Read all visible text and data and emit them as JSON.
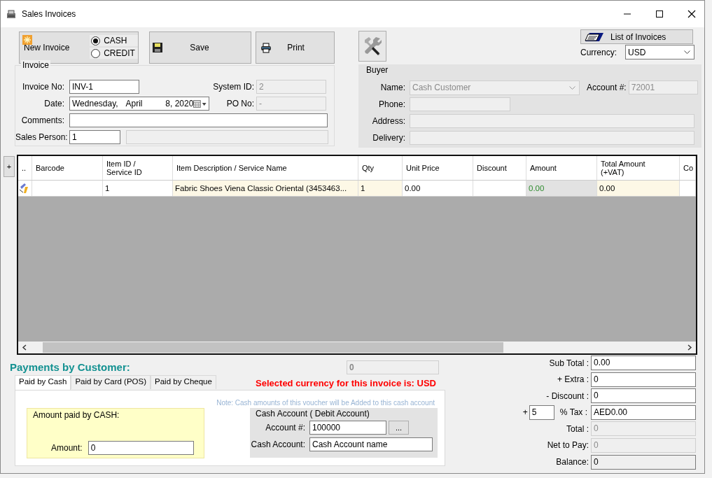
{
  "window": {
    "title": "Sales Invoices"
  },
  "toolbar": {
    "new_invoice": "New Invoice",
    "payment_types": [
      {
        "label": "CASH",
        "selected": true
      },
      {
        "label": "CREDIT",
        "selected": false
      }
    ],
    "save": "Save",
    "print": "Print",
    "list_of_invoices": "List of Invoices",
    "currency": {
      "label": "Currency:",
      "value": "USD"
    }
  },
  "invoice": {
    "title": "Invoice",
    "invoice_no": {
      "label": "Invoice No:",
      "value": "INV-1"
    },
    "date": {
      "label": "Date:",
      "weekday": "Wednesday,",
      "month": "April",
      "day_year": "8, 2020"
    },
    "system_id": {
      "label": "System ID:",
      "value": "2"
    },
    "po_no": {
      "label": "PO No:",
      "value": "-"
    },
    "comments": {
      "label": "Comments:"
    },
    "sales_person": {
      "label": "Sales Person:",
      "value": "1"
    }
  },
  "buyer": {
    "title": "Buyer",
    "name": {
      "label": "Name:",
      "value": "Cash Customer"
    },
    "account": {
      "label": "Account #:",
      "value": "72001"
    },
    "phone": {
      "label": "Phone:"
    },
    "address": {
      "label": "Address:"
    },
    "delivery": {
      "label": "Delivery:"
    }
  },
  "grid": {
    "add": "+",
    "columns": [
      {
        "kind": "indicator",
        "lines": [
          ".."
        ]
      },
      {
        "kind": "plain",
        "lines": [
          "Barcode"
        ]
      },
      {
        "kind": "plain",
        "lines": [
          "Item ID /",
          "Service ID"
        ]
      },
      {
        "kind": "entry",
        "lines": [
          "Item Description  / Service Name"
        ]
      },
      {
        "kind": "entry",
        "lines": [
          "Qty"
        ]
      },
      {
        "kind": "plain",
        "lines": [
          "Unit Price"
        ]
      },
      {
        "kind": "plain",
        "lines": [
          "Discount"
        ]
      },
      {
        "kind": "computed",
        "lines": [
          "Amount"
        ]
      },
      {
        "kind": "entry",
        "lines": [
          "Total Amount",
          "(+VAT)"
        ]
      },
      {
        "kind": "plain",
        "lines": [
          "Co"
        ]
      }
    ],
    "rows": [
      {
        "cells": [
          null,
          null,
          "1",
          "Fabric Shoes Viena Classic Oriental (3453463...",
          "1",
          "0.00",
          null,
          "0.00",
          "0.00",
          null
        ]
      }
    ]
  },
  "payments": {
    "title": "Payments by Customer:",
    "paid_total": "0",
    "currency_note": "Selected currency for this invoice is: USD",
    "tabs": [
      {
        "label": "Paid by Cash",
        "selected": true
      },
      {
        "label": "Paid by Card (POS)",
        "selected": false
      },
      {
        "label": "Paid by Cheque",
        "selected": false
      }
    ],
    "note": "Note: Cash amounts of this voucher will be Added to  this cash account",
    "cash": {
      "title": "Amount paid by CASH:",
      "amount": {
        "label": "Amount:",
        "value": "0"
      }
    },
    "cash_account": {
      "title": "Cash Account ( Debit Account)",
      "account_no": {
        "label": "Account #:",
        "value": "100000"
      },
      "browse": "...",
      "name": {
        "label": "Cash Account:",
        "value": "Cash Account name"
      }
    }
  },
  "totals": [
    {
      "kind": "input",
      "label": "Sub Total :",
      "value": "0.00"
    },
    {
      "kind": "input",
      "label": "+ Extra :",
      "value": "0"
    },
    {
      "kind": "input",
      "label": "- Discount :",
      "value": "0"
    },
    {
      "kind": "tax",
      "prefix": "+",
      "rate": "5",
      "label": "% Tax :",
      "value": "AED0.00"
    },
    {
      "kind": "disabled",
      "label": "Total :",
      "value": "0"
    },
    {
      "kind": "disabled",
      "label": "Net to Pay:",
      "value": "0"
    },
    {
      "kind": "readonly",
      "label": "Balance:",
      "value": "0"
    }
  ]
}
